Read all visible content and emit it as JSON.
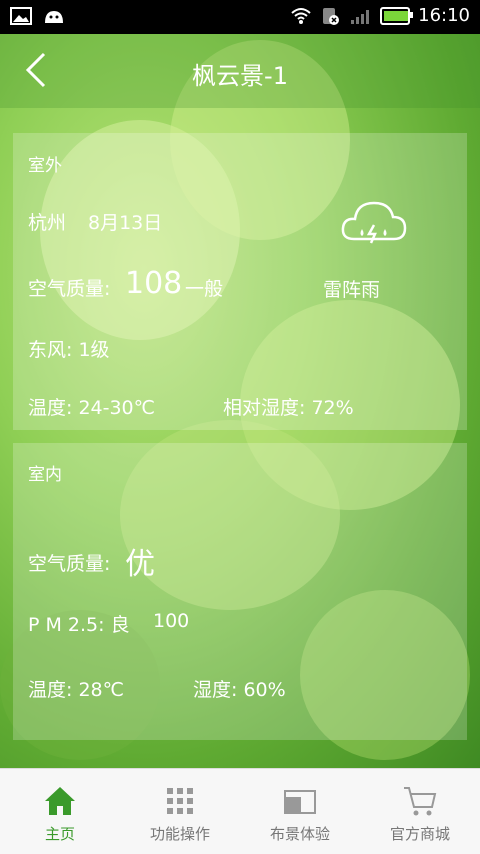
{
  "status_bar": {
    "time": "16:10",
    "icons": [
      "image-icon",
      "android-icon",
      "wifi-icon",
      "no-sim-icon",
      "signal-icon",
      "battery-icon"
    ],
    "battery_level": 0.9
  },
  "header": {
    "title": "枫云景-1",
    "back_icon": "chevron-left-icon"
  },
  "outdoor": {
    "label": "室外",
    "city": "杭州",
    "date": "8月13日",
    "aqi_label": "空气质量:",
    "aqi_value": "108",
    "aqi_level": "一般",
    "weather_icon": "thunderstorm-cloud-icon",
    "weather": "雷阵雨",
    "wind": "东风: 1级",
    "temperature": "温度: 24-30℃",
    "humidity": "相对湿度: 72%"
  },
  "indoor": {
    "label": "室内",
    "aqi_label": "空气质量:",
    "aqi_value": "优",
    "pm25": "P M 2.5: 良",
    "pm25_value": "100",
    "temperature": "温度: 28℃",
    "humidity": "湿度: 60%"
  },
  "nav": {
    "items": [
      {
        "label": "主页",
        "icon": "home-icon",
        "active": true
      },
      {
        "label": "功能操作",
        "icon": "grid-icon",
        "active": false
      },
      {
        "label": "布景体验",
        "icon": "scene-icon",
        "active": false
      },
      {
        "label": "官方商城",
        "icon": "cart-icon",
        "active": false
      }
    ],
    "active_color": "#3a9a2b",
    "inactive_color": "#777777"
  }
}
